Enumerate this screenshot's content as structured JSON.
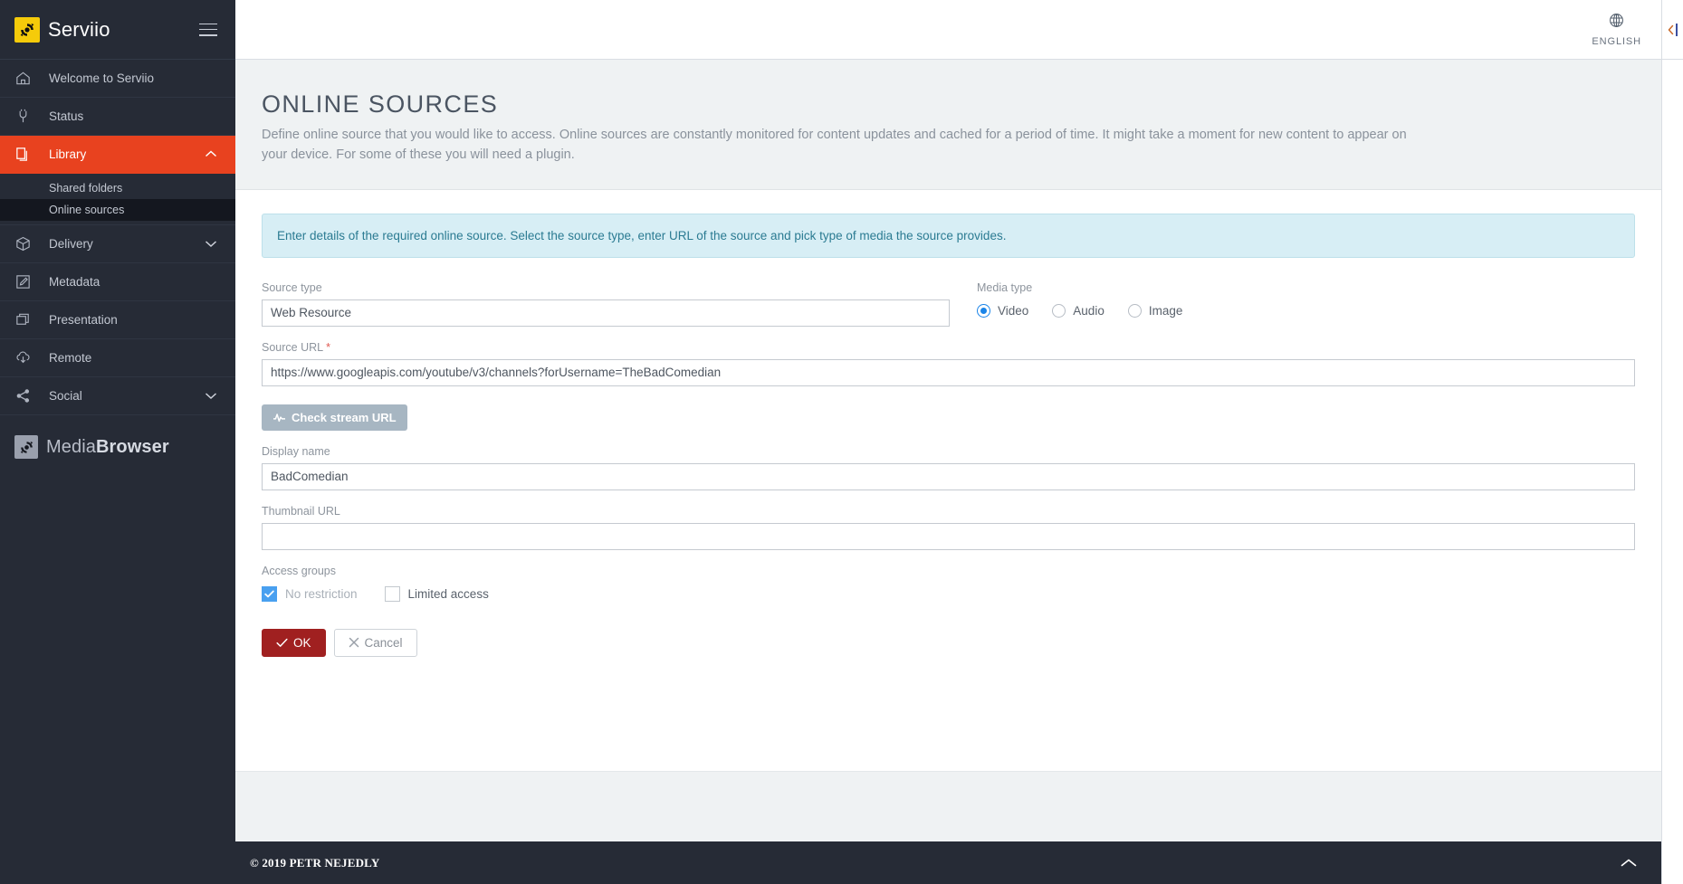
{
  "sidebar": {
    "brand": {
      "name": "Serviio",
      "logo_icon": "serviio-logo-icon",
      "menu_icon": "hamburger-icon"
    },
    "items": [
      {
        "label": "Welcome to Serviio",
        "icon": "home-icon",
        "state": "normal",
        "chevron": ""
      },
      {
        "label": "Status",
        "icon": "plug-icon",
        "state": "normal",
        "chevron": ""
      },
      {
        "label": "Library",
        "icon": "library-icon",
        "state": "active",
        "chevron": "chevron-up-icon"
      },
      {
        "label": "Delivery",
        "icon": "box-icon",
        "state": "normal",
        "chevron": "chevron-down-icon"
      },
      {
        "label": "Metadata",
        "icon": "pencil-square-icon",
        "state": "normal",
        "chevron": ""
      },
      {
        "label": "Presentation",
        "icon": "windows-icon",
        "state": "normal",
        "chevron": ""
      },
      {
        "label": "Remote",
        "icon": "cloud-download-icon",
        "state": "normal",
        "chevron": ""
      },
      {
        "label": "Social",
        "icon": "share-icon",
        "state": "normal",
        "chevron": "chevron-down-icon"
      }
    ],
    "library_subitems": [
      {
        "label": "Shared folders",
        "selected": false
      },
      {
        "label": "Online sources",
        "selected": true
      }
    ],
    "mediabrowser": {
      "prefix": "Media",
      "suffix": "Browser",
      "logo_icon": "mediabrowser-logo-icon"
    }
  },
  "topbar": {
    "language_label": "ENGLISH",
    "language_icon": "globe-icon",
    "collapse_icon": "collapse-left-icon"
  },
  "page": {
    "title": "ONLINE SOURCES",
    "description": "Define online source that you would like to access. Online sources are constantly monitored for content updates and cached for a period of time. It might take a moment for new content to appear on your device. For some of these you will need a plugin."
  },
  "form": {
    "alert": "Enter details of the required online source. Select the source type, enter URL of the source and pick type of media the source provides.",
    "source_type": {
      "label": "Source type",
      "value": "Web Resource",
      "placeholder": ""
    },
    "media_type": {
      "label": "Media type",
      "options": [
        {
          "label": "Video",
          "selected": true
        },
        {
          "label": "Audio",
          "selected": false
        },
        {
          "label": "Image",
          "selected": false
        }
      ]
    },
    "source_url": {
      "label": "Source URL",
      "required_marker": "*",
      "value": "https://www.googleapis.com/youtube/v3/channels?forUsername=TheBadComedian",
      "placeholder": ""
    },
    "check_button": {
      "label": "Check stream URL",
      "icon": "pulse-icon"
    },
    "display_name": {
      "label": "Display name",
      "value": "BadComedian",
      "placeholder": ""
    },
    "thumbnail_url": {
      "label": "Thumbnail URL",
      "value": "",
      "placeholder": ""
    },
    "access_groups": {
      "label": "Access groups",
      "options": [
        {
          "label": "No restriction",
          "checked": true,
          "disabled": true
        },
        {
          "label": "Limited access",
          "checked": false,
          "disabled": false
        }
      ]
    },
    "ok_button": {
      "label": "OK",
      "icon": "check-icon"
    },
    "cancel_button": {
      "label": "Cancel",
      "icon": "x-icon"
    }
  },
  "footer": {
    "copyright": "© 2019 PETR NEJEDLY",
    "to_top_icon": "chevron-up-icon"
  },
  "colors": {
    "sidebar_bg": "#262b36",
    "active_nav": "#e8421f",
    "brand_yellow": "#f5cb0a",
    "ok_red": "#a02020",
    "alert_bg": "#d7eef5",
    "radio_blue": "#1a84e8",
    "checkbox_blue": "#49a0f0"
  }
}
